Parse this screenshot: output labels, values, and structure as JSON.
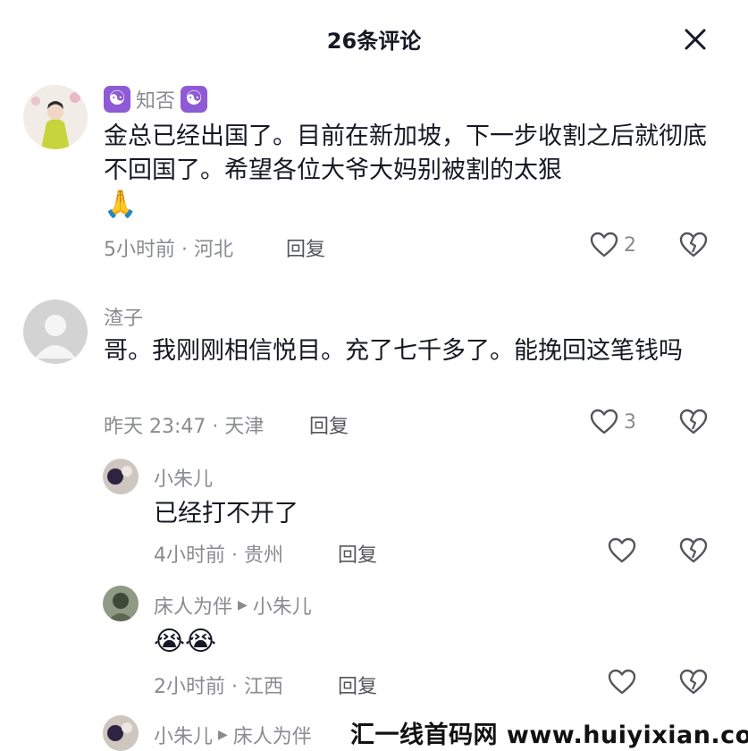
{
  "header": {
    "title": "26条评论"
  },
  "comments": [
    {
      "username": "知否",
      "text": "金总已经出国了。目前在新加坡，下一步收割之后就彻底不回国了。希望各位大爷大妈别被割的太狠",
      "emoji": "🙏",
      "meta": "5小时前 · 河北",
      "reply_label": "回复",
      "likes": "2"
    },
    {
      "username": "渣子",
      "text": "哥。我刚刚相信悦目。充了七千多了。能挽回这笔钱吗",
      "meta": "昨天 23:47 · 天津",
      "reply_label": "回复",
      "likes": "3"
    }
  ],
  "replies": [
    {
      "username": "小朱儿",
      "text": "已经打不开了",
      "meta": "4小时前 · 贵州",
      "reply_label": "回复"
    },
    {
      "username": "床人为伴",
      "reply_to": "小朱儿",
      "emoji": "😭😭",
      "meta": "2小时前 · 江西",
      "reply_label": "回复"
    },
    {
      "username": "小朱儿",
      "reply_to": "床人为伴"
    }
  ],
  "watermark": "汇一线首码网 www.huiyixian.com",
  "colors": {
    "text": "#161823",
    "secondary": "#8a8b91",
    "badge": "#8e5ad6"
  }
}
